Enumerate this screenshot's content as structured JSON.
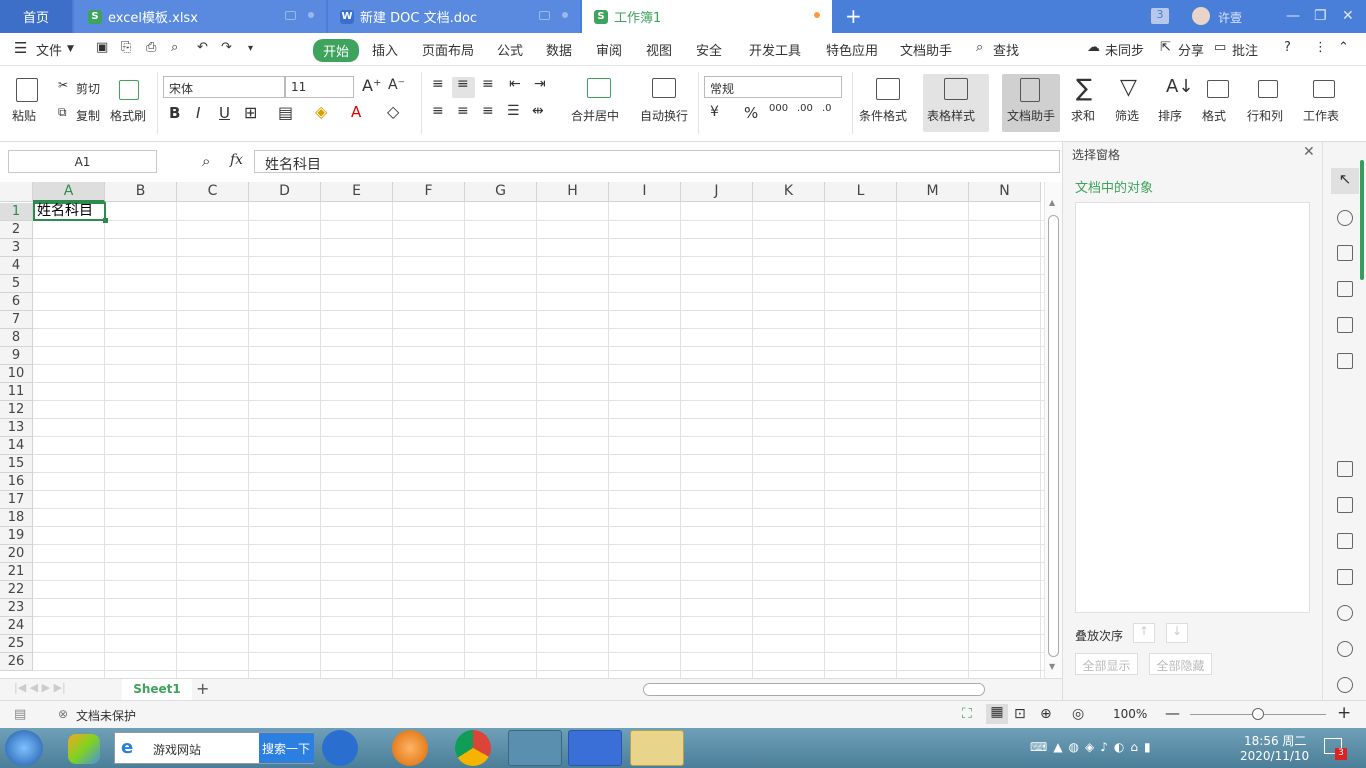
{
  "tabs": [
    {
      "label": "首页"
    },
    {
      "label": "excel模板.xlsx"
    },
    {
      "label": "新建 DOC 文档.doc"
    },
    {
      "label": "工作簿1"
    }
  ],
  "user": {
    "name": "许壹",
    "badge": "3"
  },
  "menu": {
    "file": "文件",
    "items": [
      "开始",
      "插入",
      "页面布局",
      "公式",
      "数据",
      "审阅",
      "视图",
      "安全",
      "开发工具",
      "特色应用",
      "文档助手"
    ],
    "search": "查找",
    "sync": "未同步",
    "share": "分享",
    "comment": "批注"
  },
  "ribbon": {
    "paste": "粘贴",
    "cut": "剪切",
    "copy": "复制",
    "format_painter": "格式刷",
    "font": "宋体",
    "size": "11",
    "merge": "合并居中",
    "wrap": "自动换行",
    "number_format": "常规",
    "cond_format": "条件格式",
    "table_style": "表格样式",
    "doc_helper": "文档助手",
    "sum": "求和",
    "filter": "筛选",
    "sort": "排序",
    "format": "格式",
    "rowcol": "行和列",
    "worksheet": "工作表",
    "bold": "B",
    "italic": "I",
    "underline": "U"
  },
  "formula": {
    "cell": "A1",
    "fx": "fx",
    "value": "姓名科目"
  },
  "columns": [
    "A",
    "B",
    "C",
    "D",
    "E",
    "F",
    "G",
    "H",
    "I",
    "J",
    "K",
    "L",
    "M",
    "N"
  ],
  "rows": [
    "1",
    "2",
    "3",
    "4",
    "5",
    "6",
    "7",
    "8",
    "9",
    "10",
    "11",
    "12",
    "13",
    "14",
    "15",
    "16",
    "17",
    "18",
    "19",
    "20",
    "21",
    "22",
    "23",
    "24",
    "25",
    "26"
  ],
  "cell_a1": "姓名科目",
  "panel": {
    "title": "选择窗格",
    "heading": "文档中的对象",
    "order": "叠放次序",
    "show_all": "全部显示",
    "hide_all": "全部隐藏"
  },
  "sheet": {
    "name": "Sheet1"
  },
  "status": {
    "protect": "文档未保护",
    "zoom": "100%"
  },
  "taskbar": {
    "browser_search": "游戏网站",
    "search_btn": "搜索一下",
    "time": "18:56 周二",
    "date": "2020/11/10",
    "notif": "3"
  }
}
